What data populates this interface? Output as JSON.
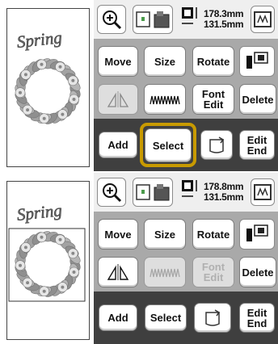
{
  "top_panel": {
    "preview": {
      "text": "Spring"
    },
    "size": {
      "width": "178.3mm",
      "height": "131.5mm"
    },
    "buttons": {
      "move": "Move",
      "size": "Size",
      "rotate": "Rotate",
      "font_edit_line1": "Font",
      "font_edit_line2": "Edit",
      "delete": "Delete",
      "add": "Add",
      "select": "Select",
      "edit_end_line1": "Edit",
      "edit_end_line2": "End"
    },
    "state": {
      "font_edit_enabled": true,
      "highlight": "select-button"
    }
  },
  "bottom_panel": {
    "preview": {
      "text": "Spring"
    },
    "size": {
      "width": "178.8mm",
      "height": "131.5mm"
    },
    "buttons": {
      "move": "Move",
      "size": "Size",
      "rotate": "Rotate",
      "font_edit_line1": "Font",
      "font_edit_line2": "Edit",
      "delete": "Delete",
      "add": "Add",
      "select": "Select",
      "edit_end_line1": "Edit",
      "edit_end_line2": "End"
    },
    "state": {
      "font_edit_enabled": false,
      "density_enabled": false
    }
  },
  "colors": {
    "highlight": "#c89a00",
    "panel": "#a9a9a9",
    "bottom_bar": "#3f3f3f"
  },
  "icons": [
    "magnify-icon",
    "hoop-select-icon",
    "size-indicator-icon",
    "hoop-icon",
    "thread-color-icon",
    "mirror-icon",
    "density-icon",
    "embroidery-frame-icon"
  ]
}
